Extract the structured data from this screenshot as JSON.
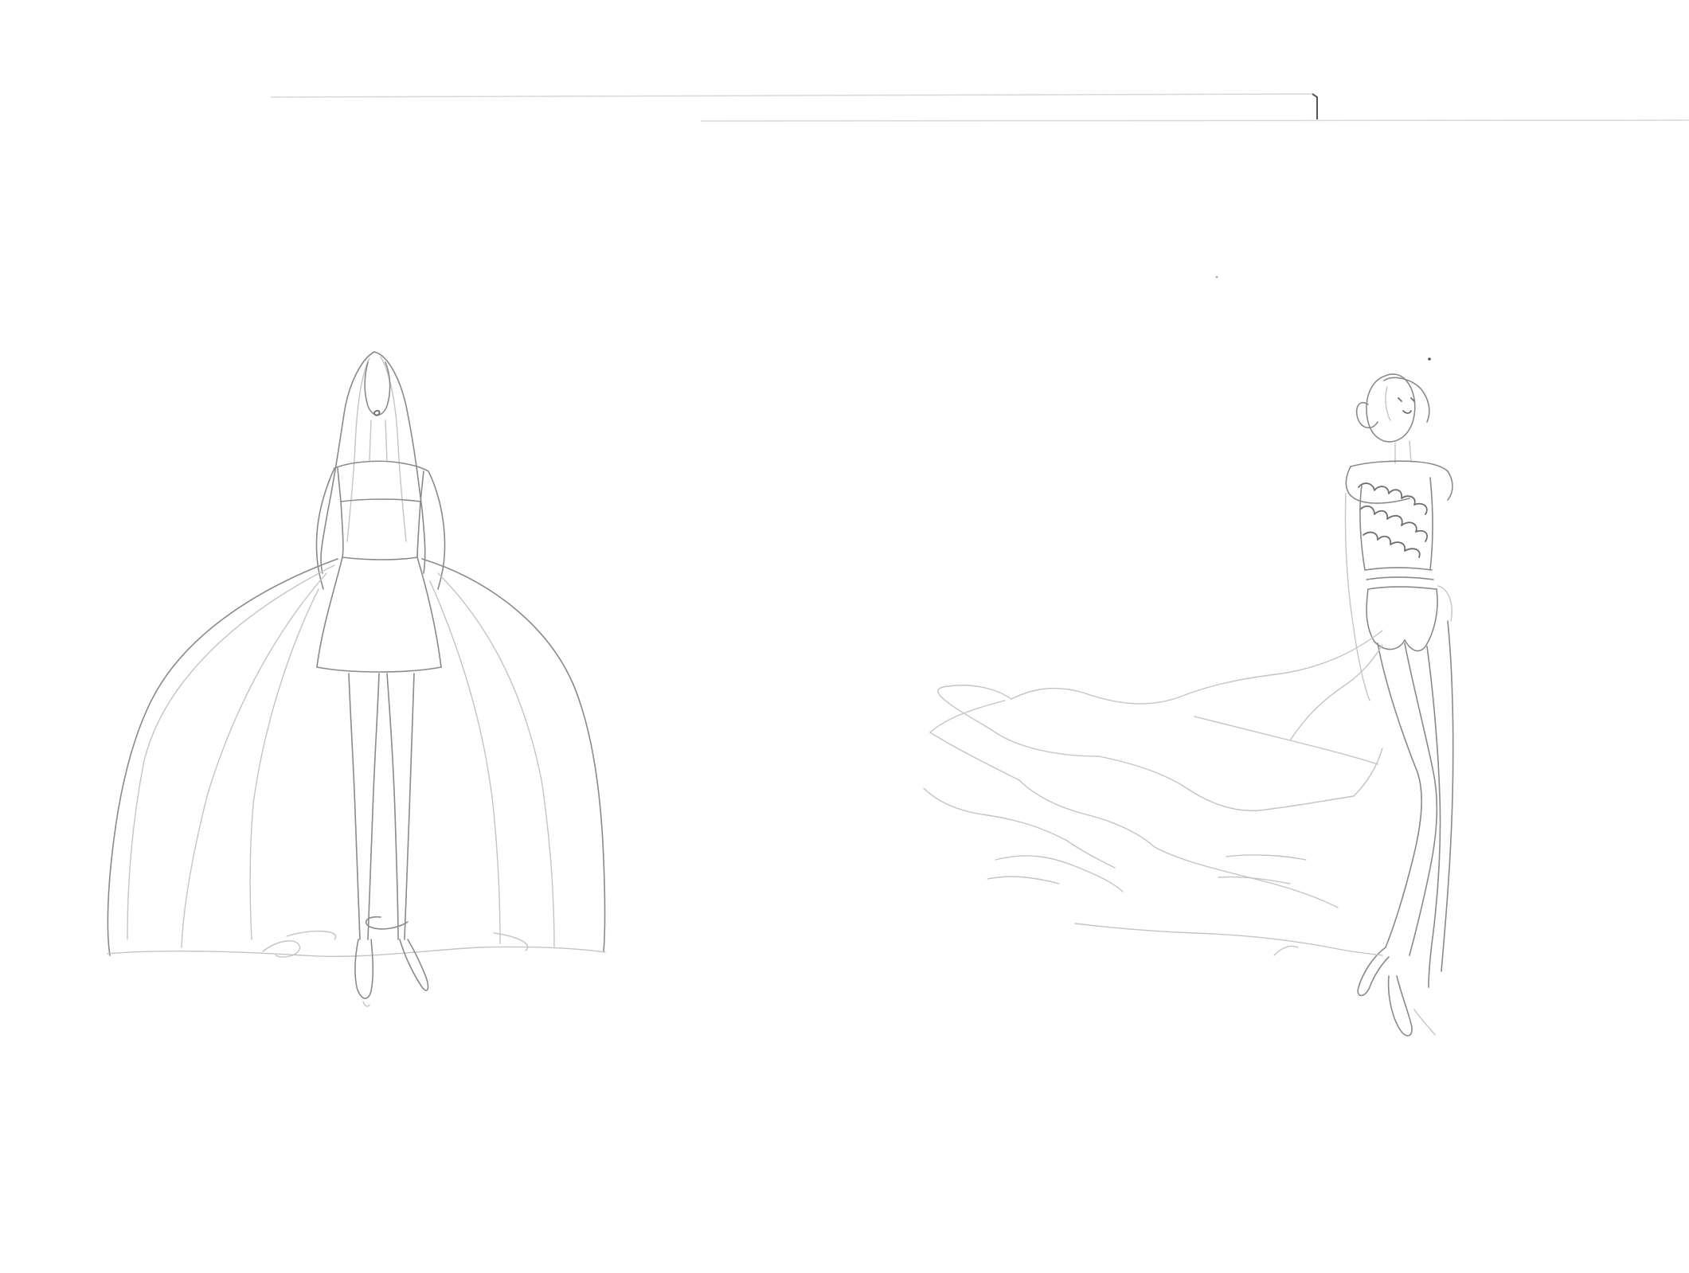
{
  "scan": {
    "paper_color": "#ffffff",
    "pencil_color": "#8a8a8a"
  },
  "sketches": [
    {
      "name": "ball-gown-figure",
      "description_icon": "dress-sketch-icon"
    },
    {
      "name": "train-gown-figure",
      "description_icon": "dress-sketch-icon"
    }
  ]
}
